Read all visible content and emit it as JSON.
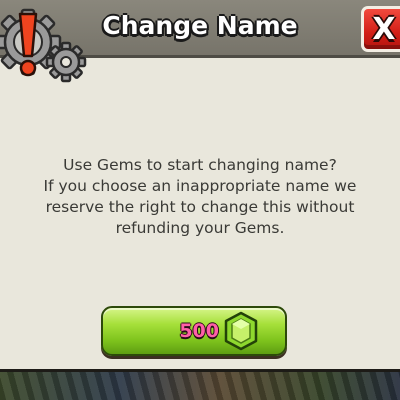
{
  "dialog": {
    "title": "Change Name",
    "close_label": "X",
    "message_lines": [
      "Use Gems to start changing name?",
      "If you choose an inappropriate name we",
      "reserve the right to change this without",
      "refunding your Gems."
    ],
    "cost": "500",
    "currency_icon": "gem-icon",
    "settings_icon": "gear-warning-icon"
  },
  "colors": {
    "header": "#7f7c72",
    "body": "#e9e7dc",
    "close": "#d9251c",
    "button": "#95d42e",
    "cost_text": "#ff5fa8",
    "gem": "#9be03c"
  }
}
